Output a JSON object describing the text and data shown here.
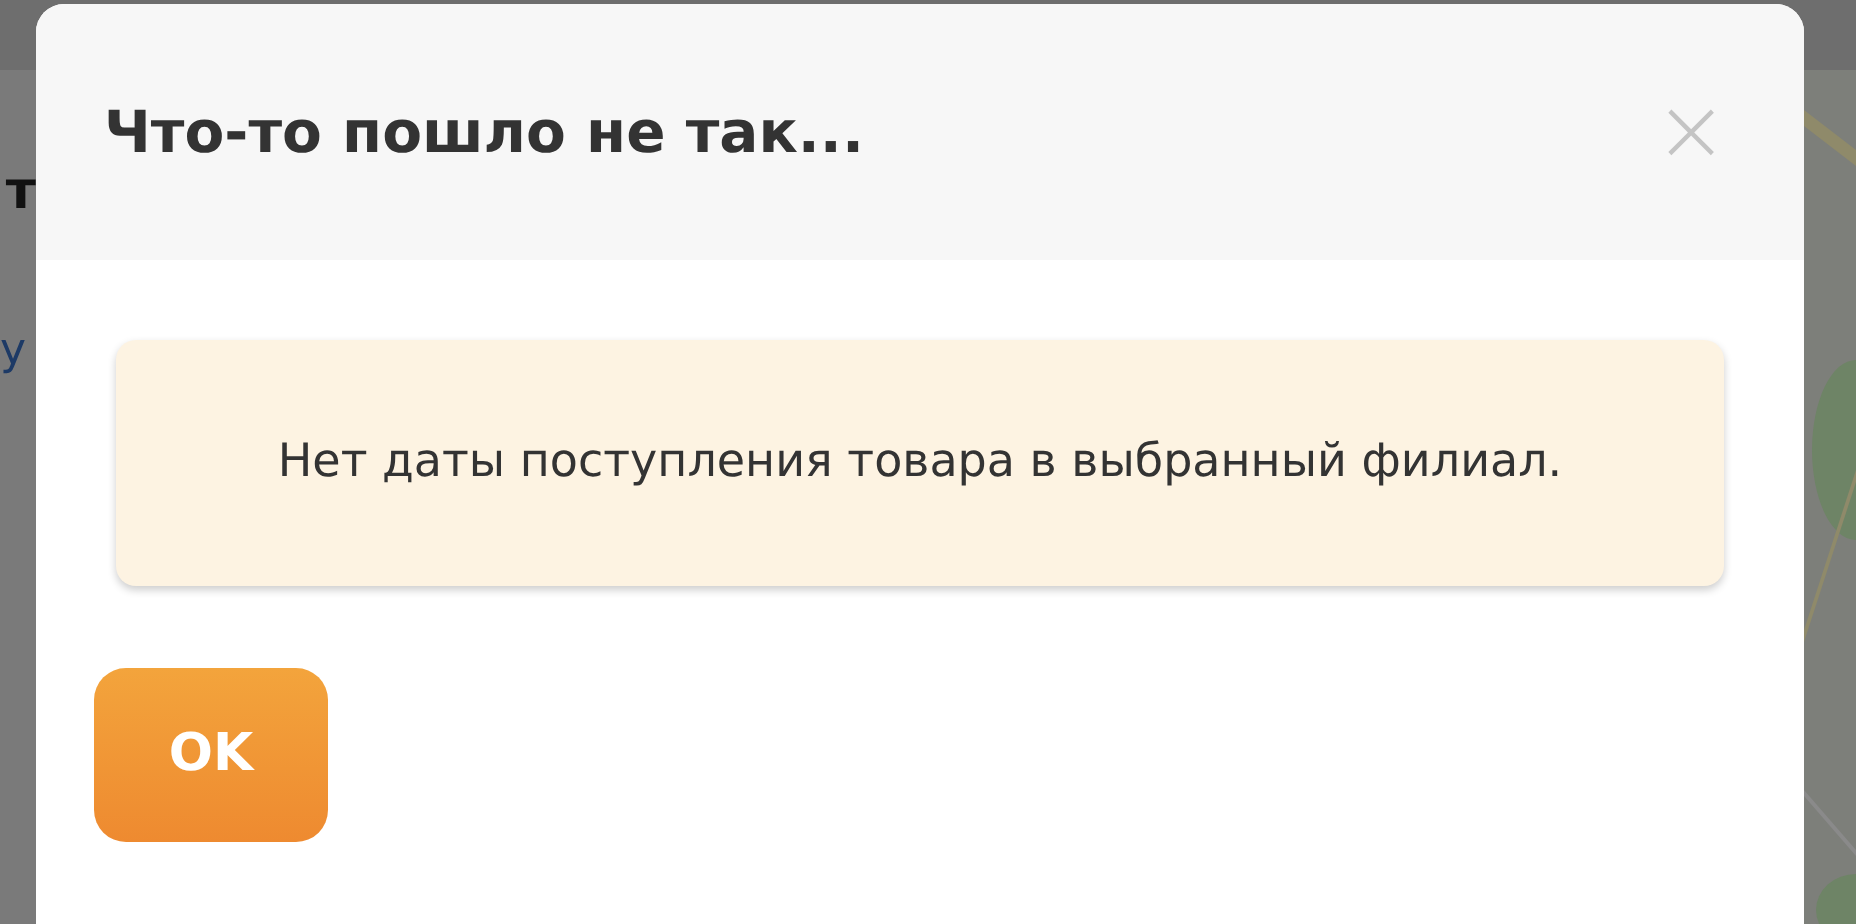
{
  "background": {
    "heading_fragment": "т",
    "link_fragment": "у"
  },
  "dialog": {
    "title": "Что-то пошло не так...",
    "close": "×",
    "message": "Нет даты поступления товара в выбранный филиал.",
    "buttons": [
      "OK"
    ]
  }
}
